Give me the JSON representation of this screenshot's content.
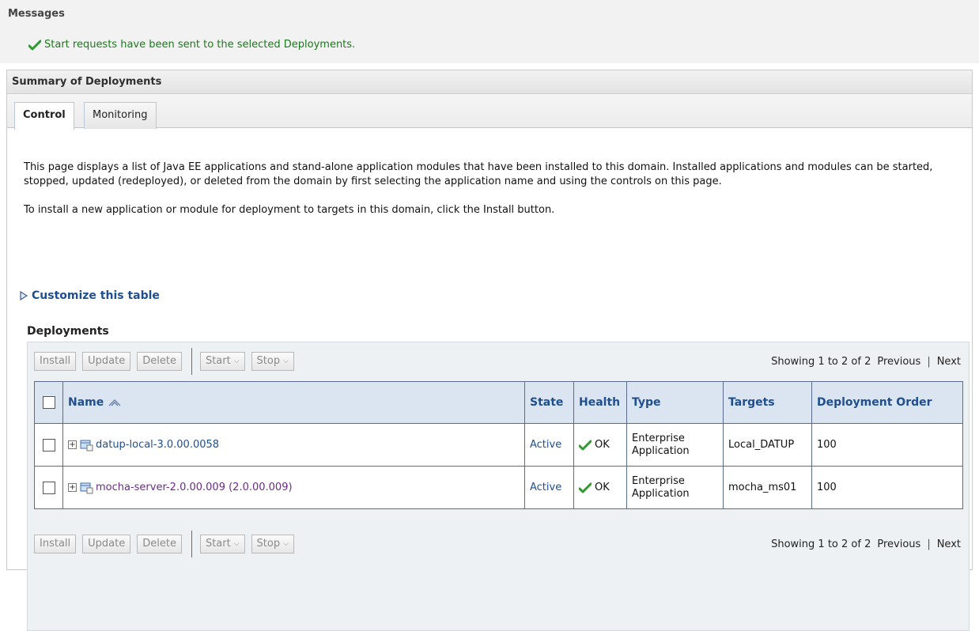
{
  "messages": {
    "title": "Messages",
    "success_text": "Start requests have been sent to the selected Deployments."
  },
  "summary": {
    "title": "Summary of Deployments",
    "tabs": [
      {
        "label": "Control",
        "active": true
      },
      {
        "label": "Monitoring",
        "active": false
      }
    ],
    "description": [
      "This page displays a list of Java EE applications and stand-alone application modules that have been installed to this domain. Installed applications and modules can be started, stopped, updated (redeployed), or deleted from the domain by first selecting the application name and using the controls on this page.",
      "To install a new application or module for deployment to targets in this domain, click the Install button."
    ],
    "customize_link": "Customize this table"
  },
  "deployments": {
    "title": "Deployments",
    "toolbar": {
      "install": "Install",
      "update": "Update",
      "delete": "Delete",
      "start": "Start",
      "stop": "Stop"
    },
    "pager": {
      "showing": "Showing 1 to 2 of 2",
      "previous": "Previous",
      "next": "Next"
    },
    "columns": [
      "Name",
      "State",
      "Health",
      "Type",
      "Targets",
      "Deployment Order"
    ],
    "rows": [
      {
        "name": "datup-local-3.0.00.0058",
        "state": "Active",
        "health": "OK",
        "type_line1": "Enterprise",
        "type_line2": "Application",
        "targets": "Local_DATUP",
        "order": "100"
      },
      {
        "name": "mocha-server-2.0.00.009 (2.0.00.009)",
        "state": "Active",
        "health": "OK",
        "type_line1": "Enterprise",
        "type_line2": "Application",
        "targets": "mocha_ms01",
        "order": "100"
      }
    ]
  },
  "colors": {
    "success_green": "#1b7a1b",
    "link_blue": "#1f4f8f",
    "visited_purple": "#6b2b8a",
    "header_bg": "#dbe5f1"
  }
}
